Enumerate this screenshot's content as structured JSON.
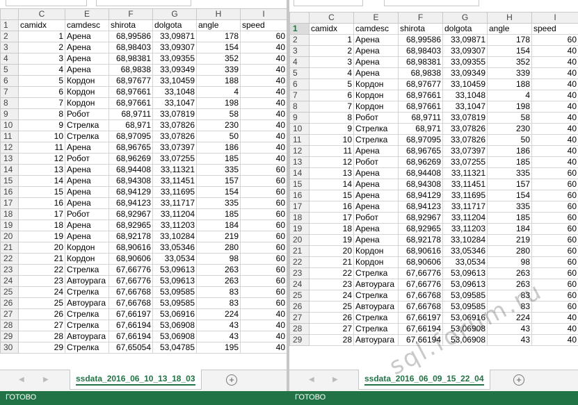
{
  "columns": [
    "C",
    "E",
    "F",
    "G",
    "H",
    "I"
  ],
  "left": {
    "sheet_tab": "ssdata_2016_06_10_13_18_03",
    "rows": [
      {
        "r": "1",
        "c": [
          "camidx",
          "camdesc",
          "shirota",
          "dolgota",
          "angle",
          "speed"
        ]
      },
      {
        "r": "2",
        "c": [
          "1",
          "Арена",
          "68,99586",
          "33,09871",
          "178",
          "60"
        ]
      },
      {
        "r": "3",
        "c": [
          "2",
          "Арена",
          "68,98403",
          "33,09307",
          "154",
          "40"
        ]
      },
      {
        "r": "4",
        "c": [
          "3",
          "Арена",
          "68,98381",
          "33,09355",
          "352",
          "40"
        ]
      },
      {
        "r": "5",
        "c": [
          "4",
          "Арена",
          "68,9838",
          "33,09349",
          "339",
          "40"
        ]
      },
      {
        "r": "6",
        "c": [
          "5",
          "Кордон",
          "68,97677",
          "33,10459",
          "188",
          "40"
        ]
      },
      {
        "r": "7",
        "c": [
          "6",
          "Кордон",
          "68,97661",
          "33,1048",
          "4",
          "40"
        ]
      },
      {
        "r": "8",
        "c": [
          "7",
          "Кордон",
          "68,97661",
          "33,1047",
          "198",
          "40"
        ]
      },
      {
        "r": "9",
        "c": [
          "8",
          "Робот",
          "68,9711",
          "33,07819",
          "58",
          "40"
        ]
      },
      {
        "r": "10",
        "c": [
          "9",
          "Стрелка",
          "68,971",
          "33,07826",
          "230",
          "40"
        ]
      },
      {
        "r": "11",
        "c": [
          "10",
          "Стрелка",
          "68,97095",
          "33,07826",
          "50",
          "40"
        ]
      },
      {
        "r": "12",
        "c": [
          "11",
          "Арена",
          "68,96765",
          "33,07397",
          "186",
          "40"
        ]
      },
      {
        "r": "13",
        "c": [
          "12",
          "Робот",
          "68,96269",
          "33,07255",
          "185",
          "40"
        ]
      },
      {
        "r": "14",
        "c": [
          "13",
          "Арена",
          "68,94408",
          "33,11321",
          "335",
          "60"
        ]
      },
      {
        "r": "15",
        "c": [
          "14",
          "Арена",
          "68,94308",
          "33,11451",
          "157",
          "60"
        ]
      },
      {
        "r": "16",
        "c": [
          "15",
          "Арена",
          "68,94129",
          "33,11695",
          "154",
          "60"
        ]
      },
      {
        "r": "17",
        "c": [
          "16",
          "Арена",
          "68,94123",
          "33,11717",
          "335",
          "60"
        ]
      },
      {
        "r": "18",
        "c": [
          "17",
          "Робот",
          "68,92967",
          "33,11204",
          "185",
          "60"
        ]
      },
      {
        "r": "19",
        "c": [
          "18",
          "Арена",
          "68,92965",
          "33,11203",
          "184",
          "60"
        ]
      },
      {
        "r": "20",
        "c": [
          "19",
          "Арена",
          "68,92178",
          "33,10284",
          "219",
          "60"
        ]
      },
      {
        "r": "21",
        "c": [
          "20",
          "Кордон",
          "68,90616",
          "33,05346",
          "280",
          "60"
        ]
      },
      {
        "r": "22",
        "c": [
          "21",
          "Кордон",
          "68,90606",
          "33,0534",
          "98",
          "60"
        ]
      },
      {
        "r": "23",
        "c": [
          "22",
          "Стрелка",
          "67,66776",
          "53,09613",
          "263",
          "60"
        ]
      },
      {
        "r": "24",
        "c": [
          "23",
          "Автоурага",
          "67,66776",
          "53,09613",
          "263",
          "60"
        ]
      },
      {
        "r": "25",
        "c": [
          "24",
          "Стрелка",
          "67,66768",
          "53,09585",
          "83",
          "60"
        ]
      },
      {
        "r": "26",
        "c": [
          "25",
          "Автоурага",
          "67,66768",
          "53,09585",
          "83",
          "60"
        ]
      },
      {
        "r": "27",
        "c": [
          "26",
          "Стрелка",
          "67,66197",
          "53,06916",
          "224",
          "40"
        ]
      },
      {
        "r": "28",
        "c": [
          "27",
          "Стрелка",
          "67,66194",
          "53,06908",
          "43",
          "40"
        ]
      },
      {
        "r": "29",
        "c": [
          "28",
          "Автоурага",
          "67,66194",
          "53,06908",
          "43",
          "40"
        ]
      },
      {
        "r": "30",
        "c": [
          "29",
          "Стрелка",
          "67,65054",
          "53,04785",
          "195",
          "40"
        ]
      }
    ]
  },
  "right": {
    "sheet_tab": "ssdata_2016_06_09_15_22_04",
    "rows": [
      {
        "r": "1",
        "c": [
          "camidx",
          "camdesc",
          "shirota",
          "dolgota",
          "angle",
          "speed"
        ]
      },
      {
        "r": "2",
        "c": [
          "1",
          "Арена",
          "68,99586",
          "33,09871",
          "178",
          "60"
        ]
      },
      {
        "r": "3",
        "c": [
          "2",
          "Арена",
          "68,98403",
          "33,09307",
          "154",
          "40"
        ]
      },
      {
        "r": "4",
        "c": [
          "3",
          "Арена",
          "68,98381",
          "33,09355",
          "352",
          "40"
        ]
      },
      {
        "r": "5",
        "c": [
          "4",
          "Арена",
          "68,9838",
          "33,09349",
          "339",
          "40"
        ]
      },
      {
        "r": "6",
        "c": [
          "5",
          "Кордон",
          "68,97677",
          "33,10459",
          "188",
          "40"
        ]
      },
      {
        "r": "7",
        "c": [
          "6",
          "Кордон",
          "68,97661",
          "33,1048",
          "4",
          "40"
        ]
      },
      {
        "r": "8",
        "c": [
          "7",
          "Кордон",
          "68,97661",
          "33,1047",
          "198",
          "40"
        ]
      },
      {
        "r": "9",
        "c": [
          "8",
          "Робот",
          "68,9711",
          "33,07819",
          "58",
          "40"
        ]
      },
      {
        "r": "10",
        "c": [
          "9",
          "Стрелка",
          "68,971",
          "33,07826",
          "230",
          "40"
        ]
      },
      {
        "r": "11",
        "c": [
          "10",
          "Стрелка",
          "68,97095",
          "33,07826",
          "50",
          "40"
        ]
      },
      {
        "r": "12",
        "c": [
          "11",
          "Арена",
          "68,96765",
          "33,07397",
          "186",
          "40"
        ]
      },
      {
        "r": "13",
        "c": [
          "12",
          "Робот",
          "68,96269",
          "33,07255",
          "185",
          "40"
        ]
      },
      {
        "r": "14",
        "c": [
          "13",
          "Арена",
          "68,94408",
          "33,11321",
          "335",
          "60"
        ]
      },
      {
        "r": "15",
        "c": [
          "14",
          "Арена",
          "68,94308",
          "33,11451",
          "157",
          "60"
        ]
      },
      {
        "r": "16",
        "c": [
          "15",
          "Арена",
          "68,94129",
          "33,11695",
          "154",
          "60"
        ]
      },
      {
        "r": "17",
        "c": [
          "16",
          "Арена",
          "68,94123",
          "33,11717",
          "335",
          "60"
        ]
      },
      {
        "r": "18",
        "c": [
          "17",
          "Робот",
          "68,92967",
          "33,11204",
          "185",
          "60"
        ]
      },
      {
        "r": "19",
        "c": [
          "18",
          "Арена",
          "68,92965",
          "33,11203",
          "184",
          "60"
        ]
      },
      {
        "r": "20",
        "c": [
          "19",
          "Арена",
          "68,92178",
          "33,10284",
          "219",
          "60"
        ]
      },
      {
        "r": "21",
        "c": [
          "20",
          "Кордон",
          "68,90616",
          "33,05346",
          "280",
          "60"
        ]
      },
      {
        "r": "22",
        "c": [
          "21",
          "Кордон",
          "68,90606",
          "33,0534",
          "98",
          "60"
        ]
      },
      {
        "r": "23",
        "c": [
          "22",
          "Стрелка",
          "67,66776",
          "53,09613",
          "263",
          "60"
        ]
      },
      {
        "r": "24",
        "c": [
          "23",
          "Автоурага",
          "67,66776",
          "53,09613",
          "263",
          "60"
        ]
      },
      {
        "r": "25",
        "c": [
          "24",
          "Стрелка",
          "67,66768",
          "53,09585",
          "83",
          "60"
        ]
      },
      {
        "r": "26",
        "c": [
          "25",
          "Автоурага",
          "67,66768",
          "53,09585",
          "83",
          "60"
        ]
      },
      {
        "r": "27",
        "c": [
          "26",
          "Стрелка",
          "67,66197",
          "53,06916",
          "224",
          "40"
        ]
      },
      {
        "r": "28",
        "c": [
          "27",
          "Стрелка",
          "67,66194",
          "53,06908",
          "43",
          "40"
        ]
      },
      {
        "r": "29",
        "c": [
          "28",
          "Автоурага",
          "67,66194",
          "53,06908",
          "43",
          "40"
        ]
      }
    ]
  },
  "status": {
    "left_text": "ГОТОВО",
    "right_text": "ГОТОВО"
  },
  "watermark": "sql.forum.ru",
  "icons": {
    "add_sheet": "plus-circle-icon",
    "nav_prev": "triangle-left-icon",
    "nav_next": "triangle-right-icon"
  },
  "colors": {
    "status_bar": "#217346",
    "tab_text": "#217346"
  }
}
